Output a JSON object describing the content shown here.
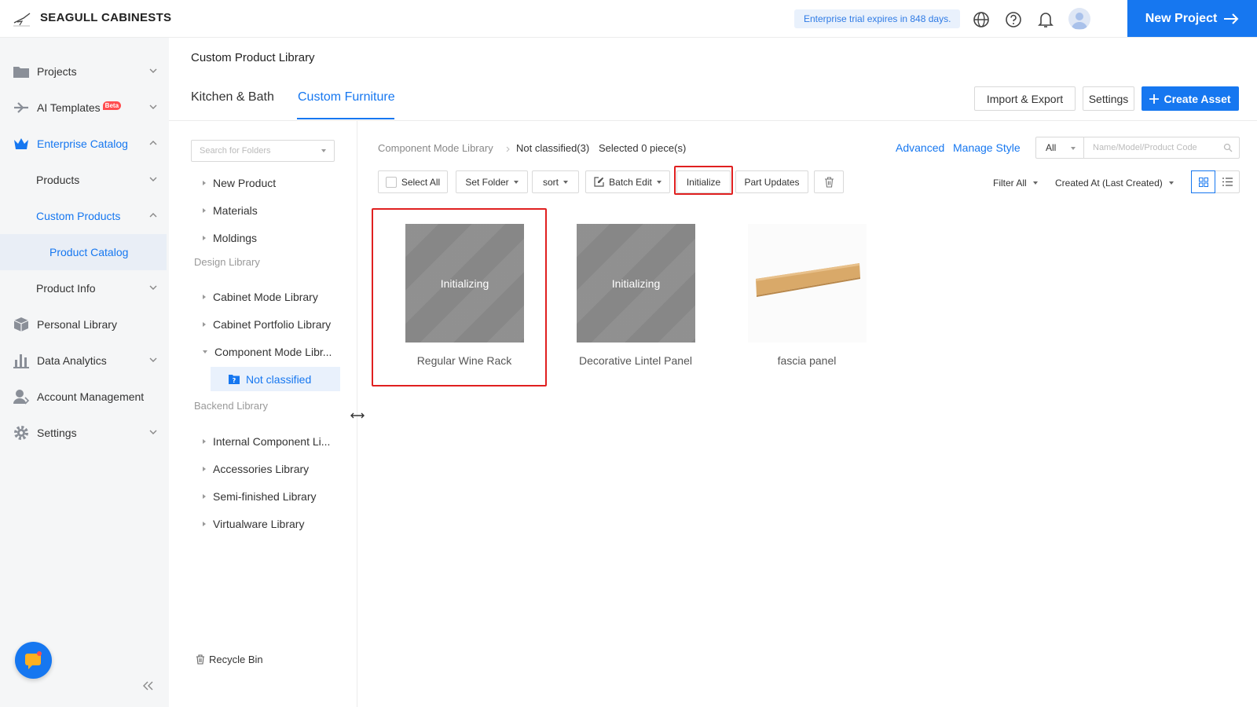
{
  "topbar": {
    "brand": "SEAGULL CABINESTS",
    "trial_notice": "Enterprise trial expires in 848 days.",
    "new_project_label": "New Project"
  },
  "sidebar": {
    "items": [
      {
        "label": "Projects",
        "icon": "folder-icon"
      },
      {
        "label": "AI Templates",
        "badge": "Beta",
        "icon": "ai-templates-icon"
      },
      {
        "label": "Enterprise Catalog",
        "icon": "crown-icon"
      },
      {
        "label": "Products"
      },
      {
        "label": "Custom Products"
      },
      {
        "label": "Product Catalog"
      },
      {
        "label": "Product Info"
      },
      {
        "label": "Personal Library",
        "icon": "cube-icon"
      },
      {
        "label": "Data Analytics",
        "icon": "bar-chart-icon"
      },
      {
        "label": "Account Management",
        "icon": "user-icon"
      },
      {
        "label": "Settings",
        "icon": "gear-icon"
      }
    ]
  },
  "header": {
    "title": "Custom Product Library",
    "tabs": [
      "Kitchen & Bath",
      "Custom Furniture"
    ],
    "active_tab": "Custom Furniture",
    "import_export_label": "Import & Export",
    "settings_label": "Settings",
    "create_asset_label": "Create Asset"
  },
  "tree": {
    "search_placeholder": "Search for Folders",
    "top_items": [
      "New Product",
      "Materials",
      "Moldings"
    ],
    "design_group": "Design Library",
    "design_items": [
      "Cabinet Mode Library",
      "Cabinet Portfolio Library",
      "Component Mode Libr..."
    ],
    "selected_folder": "Not classified",
    "backend_group": "Backend Library",
    "backend_items": [
      "Internal Component Li...",
      "Accessories Library",
      "Semi-finished Library",
      "Virtualware Library"
    ],
    "recycle_bin": "Recycle Bin"
  },
  "content": {
    "breadcrumb_root": "Component Mode Library",
    "breadcrumb_current": "Not classified(3)",
    "selected_count": "Selected 0 piece(s)",
    "advanced_label": "Advanced",
    "manage_style_label": "Manage Style",
    "filter_value": "All",
    "search_placeholder": "Name/Model/Product Code",
    "toolbar": {
      "select_all": "Select All",
      "set_folder": "Set Folder",
      "sort": "sort",
      "batch_edit": "Batch Edit",
      "initialize": "Initialize",
      "part_updates": "Part Updates"
    },
    "filter_all": "Filter All",
    "sort_by": "Created At (Last Created)",
    "cards": [
      {
        "name": "Regular Wine Rack",
        "status": "Initializing"
      },
      {
        "name": "Decorative Lintel Panel",
        "status": "Initializing"
      },
      {
        "name": "fascia panel",
        "status": ""
      }
    ]
  },
  "colors": {
    "accent": "#1677f0",
    "highlight": "#e02020",
    "placeholder_thumb": "#8c8c8c",
    "wood": "#d9a969"
  }
}
